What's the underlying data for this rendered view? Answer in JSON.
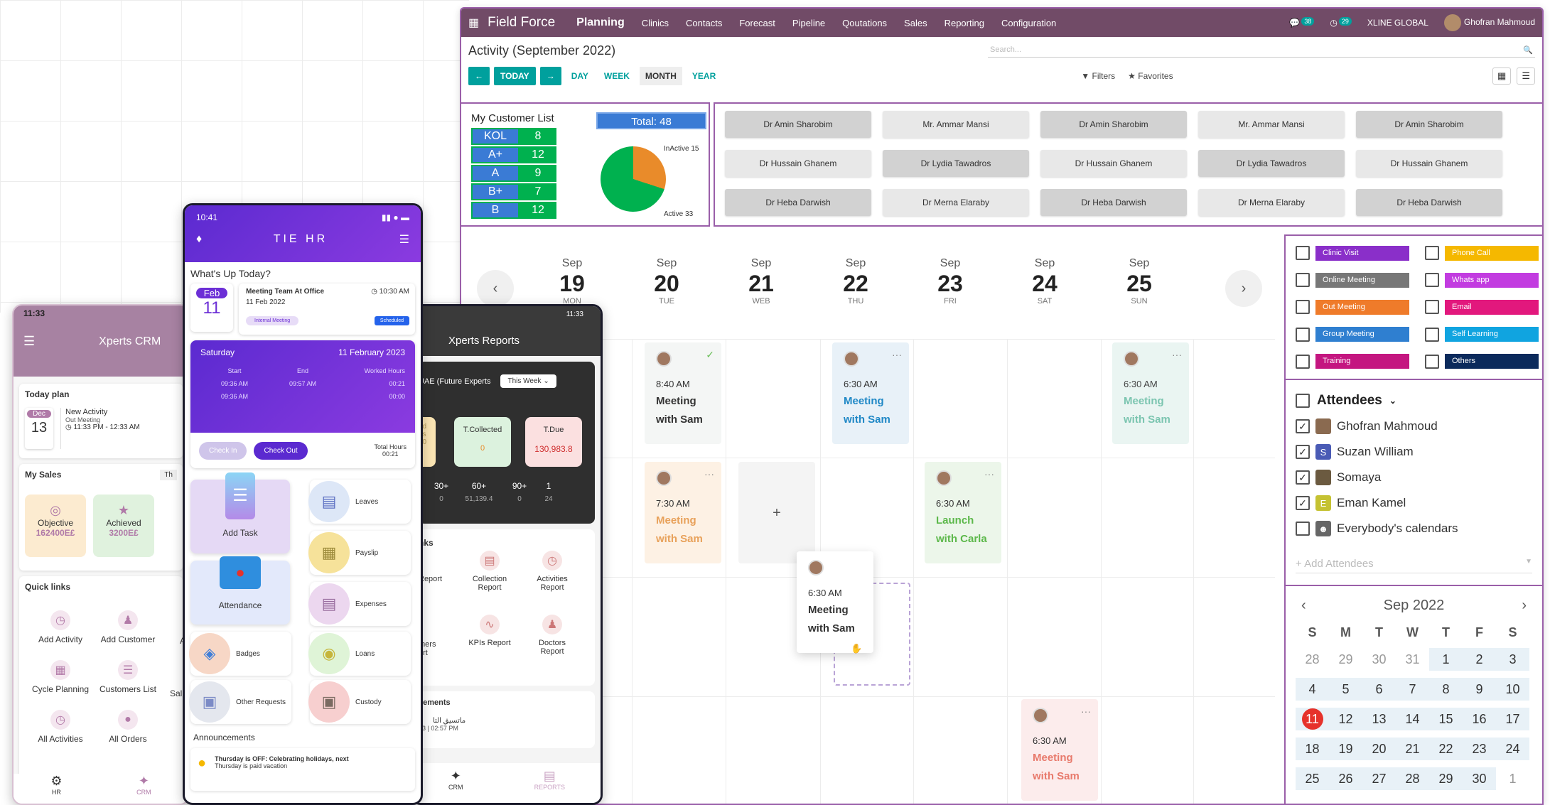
{
  "web": {
    "brand": "Field Force",
    "menu": [
      "Planning",
      "Clinics",
      "Contacts",
      "Forecast",
      "Pipeline",
      "Qoutations",
      "Sales",
      "Reporting",
      "Configuration"
    ],
    "msg_count": "38",
    "activity_count": "29",
    "company": "XLINE GLOBAL",
    "user": "Ghofran Mahmoud",
    "title": "Activity (September 2022)",
    "search_placeholder": "Search...",
    "today_label": "TODAY",
    "views": [
      "DAY",
      "WEEK",
      "MONTH",
      "YEAR"
    ],
    "filters_label": "Filters",
    "favorites_label": "Favorites",
    "customer_list": {
      "title": "My Customer List",
      "total": "Total: 48",
      "segments": [
        {
          "name": "KOL",
          "value": "8"
        },
        {
          "name": "A+",
          "value": "12"
        },
        {
          "name": "A",
          "value": "9"
        },
        {
          "name": "B+",
          "value": "7"
        },
        {
          "name": "B",
          "value": "12"
        }
      ],
      "inactive_label": "InActive 15",
      "active_label": "Active 33",
      "pie": [
        {
          "name": "InActive",
          "value": 15,
          "color": "#e98b2a"
        },
        {
          "name": "Active",
          "value": 33,
          "color": "#00b14f"
        }
      ]
    },
    "doctors": [
      "Dr Amin Sharobim",
      "Mr. Ammar Mansi",
      "Dr Amin Sharobim",
      "Mr. Ammar Mansi",
      "Dr Amin Sharobim",
      "Dr Hussain Ghanem",
      "Dr Lydia Tawadros",
      "Dr Hussain Ghanem",
      "Dr Lydia Tawadros",
      "Dr Hussain Ghanem",
      "Dr Heba Darwish",
      "Dr Merna Elaraby",
      "Dr Heba Darwish",
      "Dr Merna Elaraby",
      "Dr Heba Darwish"
    ],
    "days": [
      {
        "m": "Sep",
        "d": "19",
        "w": "MON"
      },
      {
        "m": "Sep",
        "d": "20",
        "w": "TUE"
      },
      {
        "m": "Sep",
        "d": "21",
        "w": "WEB"
      },
      {
        "m": "Sep",
        "d": "22",
        "w": "THU"
      },
      {
        "m": "Sep",
        "d": "23",
        "w": "FRI"
      },
      {
        "m": "Sep",
        "d": "24",
        "w": "SAT"
      },
      {
        "m": "Sep",
        "d": "25",
        "w": "SUN"
      }
    ],
    "events": [
      {
        "time": "8:40 AM",
        "l1": "Meeting",
        "l2": "with Sam"
      },
      {
        "time": "6:30 AM",
        "l1": "Meeting",
        "l2": "with Sam"
      },
      {
        "time": "6:30 AM",
        "l1": "Meeting",
        "l2": "with Sam"
      },
      {
        "time": "7:30 AM",
        "l1": "Meeting",
        "l2": "with Sam"
      },
      {
        "time": "6:30 AM",
        "l1": "Launch",
        "l2": "with Carla"
      },
      {
        "time": "6:30 AM",
        "l1": "Meeting",
        "l2": "with Sam"
      },
      {
        "time": "6:30 AM",
        "l1": "Meeting",
        "l2": "with Sam"
      }
    ],
    "activity_types": [
      {
        "label": "Clinic Visit",
        "color": "#8a2fc9"
      },
      {
        "label": "Phone Call",
        "color": "#f5b800"
      },
      {
        "label": "Online Meeting",
        "color": "#777777"
      },
      {
        "label": "Whats app",
        "color": "#c23ce0"
      },
      {
        "label": "Out Meeting",
        "color": "#ef7b2a"
      },
      {
        "label": "Email",
        "color": "#e2187d"
      },
      {
        "label": "Group Meeting",
        "color": "#2f7fd0"
      },
      {
        "label": "Self Learning",
        "color": "#10a4e0"
      },
      {
        "label": "Training",
        "color": "#c41680"
      },
      {
        "label": "Others",
        "color": "#0b2a5c"
      }
    ],
    "attendees": {
      "title": "Attendees",
      "list": [
        {
          "name": "Ghofran Mahmoud",
          "checked": true,
          "initial": "",
          "color": "#8a6a50"
        },
        {
          "name": "Suzan William",
          "checked": true,
          "initial": "S",
          "color": "#4a5bb5"
        },
        {
          "name": "Somaya",
          "checked": true,
          "initial": "",
          "color": "#6b5a40"
        },
        {
          "name": "Eman Kamel",
          "checked": true,
          "initial": "E",
          "color": "#c5c232"
        },
        {
          "name": "Everybody's calendars",
          "checked": false,
          "initial": "",
          "color": "#666666"
        }
      ],
      "add_placeholder": "+ Add Attendees"
    },
    "mini_cal": {
      "title": "Sep 2022",
      "weekdays": [
        "S",
        "M",
        "T",
        "W",
        "T",
        "F",
        "S"
      ],
      "cells": [
        "28",
        "29",
        "30",
        "31",
        "1",
        "2",
        "3",
        "4",
        "5",
        "6",
        "7",
        "8",
        "9",
        "10",
        "11",
        "12",
        "13",
        "14",
        "15",
        "16",
        "17",
        "18",
        "19",
        "20",
        "21",
        "22",
        "23",
        "24",
        "25",
        "26",
        "27",
        "28",
        "29",
        "30",
        "1"
      ],
      "today": "11"
    }
  },
  "xperts_crm": {
    "time": "11:33",
    "title": "Xperts CRM",
    "today_plan": "Today plan",
    "month": "Dec",
    "day": "13",
    "activity_title": "New Activity",
    "activity_type": "Out Meeting",
    "activity_time": "11:33 PM - 12:33 AM",
    "my_sales": "My Sales",
    "period_tab": "Th",
    "objective_label": "Objective",
    "objective_value": "162400E£",
    "achieved_label": "Achieved",
    "achieved_value": "3200E£",
    "quick_links_title": "Quick links",
    "quick_links": [
      "Add Activity",
      "Add Customer",
      "Cycle Planning",
      "Customers List",
      "All Activities",
      "All Orders"
    ],
    "quick_links_clipped": [
      "A",
      "Sal"
    ],
    "nav": [
      "HR",
      "CRM"
    ]
  },
  "xperts_reports": {
    "time": "11:33",
    "title": "Xperts Reports",
    "company": "UAE (Future Experts",
    "period": "This Week",
    "tiles": [
      {
        "label": "T.Collected",
        "value": "0"
      },
      {
        "label": "T.Due",
        "value": "130,983.8"
      }
    ],
    "tile_clipped": [
      "ed",
      "es",
      "30"
    ],
    "aging": [
      "30+",
      "60+",
      "90+",
      "1"
    ],
    "aging_values": [
      "0",
      "51,139.4",
      "0",
      "24"
    ],
    "aging_first_value": "0",
    "links_title": "nks",
    "links": [
      "Collection Report",
      "Activities Report",
      "KPIs Report",
      "Doctors Report"
    ],
    "links_clipped": [
      "Report",
      "mers",
      "ort"
    ],
    "ann_title": "cements",
    "ann_text": "ماتسيق التا",
    "ann_time": "23 | 02:57 PM",
    "nav": [
      "CRM",
      "REPORTS"
    ]
  },
  "tie_hr": {
    "time": "10:41",
    "title": "TIE HR",
    "whats_up": "What's Up Today?",
    "month": "Feb",
    "day": "11",
    "meeting_title": "Meeting Team At Office",
    "meeting_time": "10:30 AM",
    "meeting_date": "11 Feb 2022",
    "meeting_tag": "Internal Meeting",
    "meeting_status": "Scheduled",
    "att_day": "Saturday",
    "att_date": "11 February 2023",
    "att_cols": [
      "Start",
      "End",
      "Worked Hours"
    ],
    "att_rows": [
      [
        "09:36 AM",
        "09:57 AM",
        "00:21"
      ],
      [
        "09:36 AM",
        "",
        "00:00"
      ]
    ],
    "check_in": "Check In",
    "check_out": "Check Out",
    "total_hours_label": "Total Hours",
    "total_hours": "00:21",
    "tiles": [
      "Add Task",
      "Attendance",
      "Leaves",
      "Payslip",
      "Expenses",
      "Badges",
      "Loans",
      "Other Requests",
      "Custody"
    ],
    "announcements_title": "Announcements",
    "announcement_text": "Thursday is OFF: Celebrating holidays, next",
    "announcement_text2": "Thursday is paid vacation"
  }
}
